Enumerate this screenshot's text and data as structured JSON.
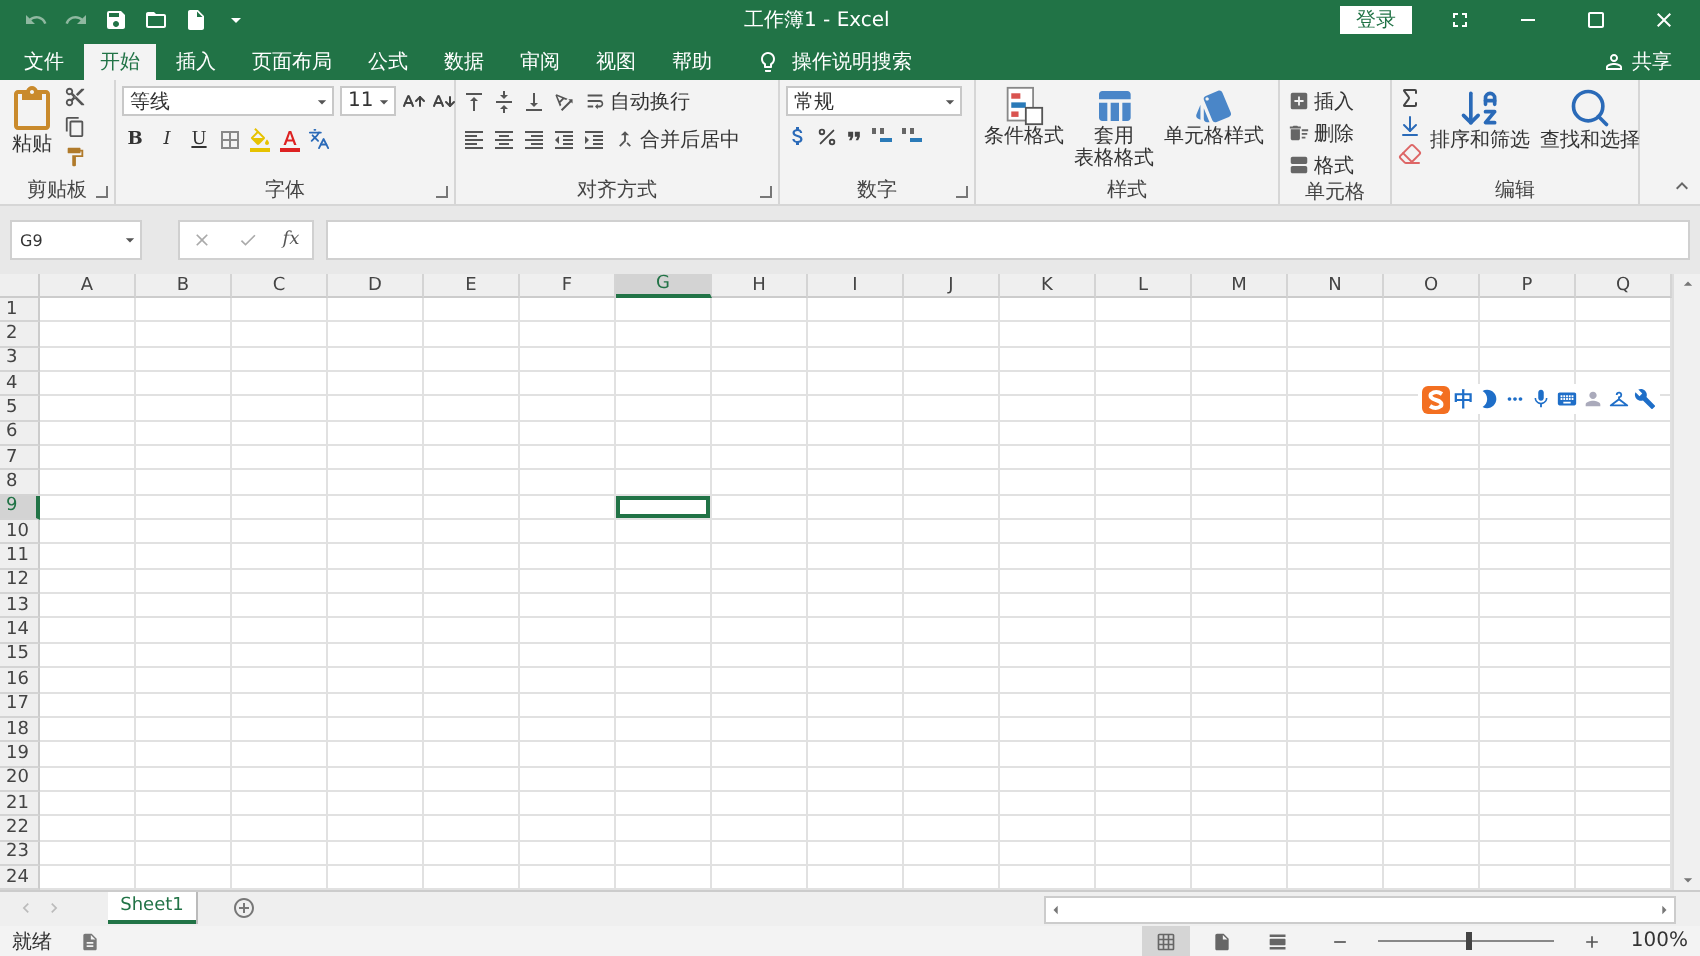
{
  "window": {
    "title": "工作簿1 - Excel",
    "sign_in": "登录"
  },
  "tabs": [
    {
      "label": "文件",
      "selected": false
    },
    {
      "label": "开始",
      "selected": true
    },
    {
      "label": "插入",
      "selected": false
    },
    {
      "label": "页面布局",
      "selected": false
    },
    {
      "label": "公式",
      "selected": false
    },
    {
      "label": "数据",
      "selected": false
    },
    {
      "label": "审阅",
      "selected": false
    },
    {
      "label": "视图",
      "selected": false
    },
    {
      "label": "帮助",
      "selected": false
    }
  ],
  "tell_me": "操作说明搜索",
  "share": "共享",
  "ribbon": {
    "clipboard": {
      "label": "剪贴板",
      "paste": "粘贴",
      "launcher": true
    },
    "font": {
      "label": "字体",
      "font_name": "等线",
      "font_size": "11",
      "styles": [
        "B",
        "I",
        "U"
      ],
      "launcher": true
    },
    "alignment": {
      "label": "对齐方式",
      "wrap": "自动换行",
      "merge": "合并后居中",
      "launcher": true
    },
    "number": {
      "label": "数字",
      "format": "常规",
      "launcher": true
    },
    "styles": {
      "label": "样式",
      "commands": [
        {
          "lines": [
            "条件格式"
          ]
        },
        {
          "lines": [
            "套用",
            "表格格式"
          ]
        },
        {
          "lines": [
            "单元格样式"
          ]
        }
      ]
    },
    "cells": {
      "label": "单元格",
      "commands": [
        "插入",
        "删除",
        "格式"
      ]
    },
    "editing": {
      "label": "编辑",
      "commands": [
        "排序和筛选",
        "查找和选择"
      ]
    }
  },
  "formula_bar": {
    "name_box": "G9",
    "fx": "fx"
  },
  "columns": [
    {
      "label": "A",
      "selected": false
    },
    {
      "label": "B",
      "selected": false
    },
    {
      "label": "C",
      "selected": false
    },
    {
      "label": "D",
      "selected": false
    },
    {
      "label": "E",
      "selected": false
    },
    {
      "label": "F",
      "selected": false
    },
    {
      "label": "G",
      "selected": true
    },
    {
      "label": "H",
      "selected": false
    },
    {
      "label": "I",
      "selected": false
    },
    {
      "label": "J",
      "selected": false
    },
    {
      "label": "K",
      "selected": false
    },
    {
      "label": "L",
      "selected": false
    },
    {
      "label": "M",
      "selected": false
    },
    {
      "label": "N",
      "selected": false
    },
    {
      "label": "O",
      "selected": false
    },
    {
      "label": "P",
      "selected": false
    },
    {
      "label": "Q",
      "selected": false
    }
  ],
  "rows": [
    {
      "label": "1",
      "selected": false
    },
    {
      "label": "2",
      "selected": false
    },
    {
      "label": "3",
      "selected": false
    },
    {
      "label": "4",
      "selected": false
    },
    {
      "label": "5",
      "selected": false
    },
    {
      "label": "6",
      "selected": false
    },
    {
      "label": "7",
      "selected": false
    },
    {
      "label": "8",
      "selected": false
    },
    {
      "label": "9",
      "selected": true
    },
    {
      "label": "10",
      "selected": false
    },
    {
      "label": "11",
      "selected": false
    },
    {
      "label": "12",
      "selected": false
    },
    {
      "label": "13",
      "selected": false
    },
    {
      "label": "14",
      "selected": false
    },
    {
      "label": "15",
      "selected": false
    },
    {
      "label": "16",
      "selected": false
    },
    {
      "label": "17",
      "selected": false
    },
    {
      "label": "18",
      "selected": false
    },
    {
      "label": "19",
      "selected": false
    },
    {
      "label": "20",
      "selected": false
    },
    {
      "label": "21",
      "selected": false
    },
    {
      "label": "22",
      "selected": false
    },
    {
      "label": "23",
      "selected": false
    },
    {
      "label": "24",
      "selected": false
    }
  ],
  "ime": {
    "mode": "中"
  },
  "sheets": [
    {
      "label": "Sheet1",
      "selected": true
    }
  ],
  "status": {
    "text": "就绪",
    "views": [
      {
        "selected": true
      },
      {
        "selected": false
      },
      {
        "selected": false
      }
    ],
    "zoom_slider": {
      "level": 0.5
    },
    "zoom": "100%"
  }
}
